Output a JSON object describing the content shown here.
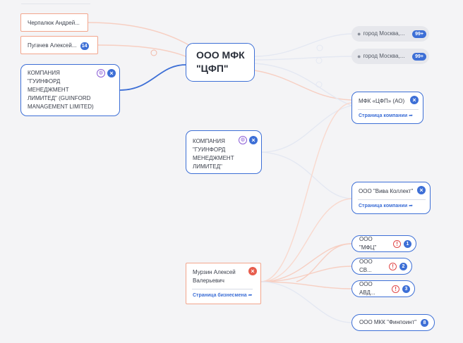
{
  "center": {
    "name": "ООО МФК",
    "name2": "\"ЦФП\""
  },
  "persons_top": [
    {
      "name": "Черпалюк Андрей..."
    },
    {
      "name": "Пугачев Алексей...",
      "badge": "14"
    }
  ],
  "company_left": {
    "lines": [
      "КОМПАНИЯ",
      "\"ГУИНФОРД",
      "МЕНЕДЖМЕНТ",
      "ЛИМИТЕД\" (GUINFORD",
      "MANAGEMENT LIMITED)"
    ]
  },
  "company_middle": {
    "lines": [
      "КОМПАНИЯ",
      "\"ГУИНФОРД",
      "МЕНЕДЖМЕНТ",
      "ЛИМИТЕД\""
    ]
  },
  "locations": [
    {
      "label": "город Москва,...",
      "badge": "99+"
    },
    {
      "label": "город Москва,...",
      "badge": "99+"
    }
  ],
  "mfk_node": {
    "name": "МФК «ЦФП» (АО)",
    "link": "Страница компании"
  },
  "viva_node": {
    "name": "ООО \"Вива Коллект\"",
    "link": "Страница компании"
  },
  "small_nodes": [
    {
      "name": "ООО \"МФЦ\"",
      "warn": true,
      "badge": "1"
    },
    {
      "name": "ООО СВ...",
      "warn": true,
      "badge": "2"
    },
    {
      "name": "ООО АВД...",
      "warn": true,
      "badge": "3"
    },
    {
      "name": "ООО МКК \"Финпоинт\"",
      "warn": false,
      "badge": "8"
    }
  ],
  "murzin": {
    "line1": "Мурзин Алексей",
    "line2": "Валерьевич",
    "link": "Страница бизнесмена"
  },
  "icons": {
    "close": "×",
    "link_arrow": "➦",
    "globe": "◍",
    "pin": "●",
    "warn": "!"
  },
  "colors": {
    "accent": "#3d6fd6",
    "person_border": "#f2a58c",
    "warn": "#e04848"
  }
}
